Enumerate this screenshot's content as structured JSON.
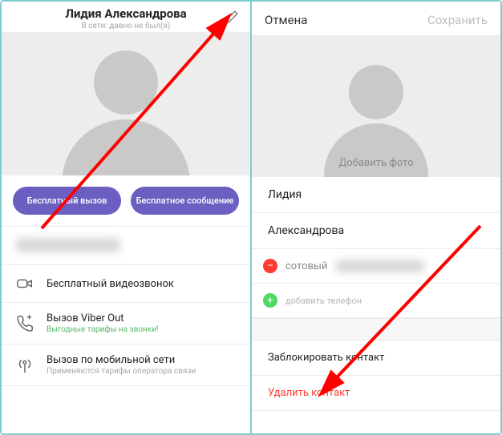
{
  "left": {
    "name": "Лидия Александрова",
    "status": "В сети: давно не был(а)",
    "buttons": {
      "free_call": "Бесплатный вызов",
      "free_msg": "Бесплатное сообщение"
    },
    "rows": {
      "video": "Бесплатный видеозвонок",
      "viber_out": "Вызов Viber Out",
      "viber_out_sub": "Выгодные тарифы на звонки!",
      "mobile": "Вызов по мобильной сети",
      "mobile_sub": "Применяются тарифы оператора связи"
    }
  },
  "right": {
    "cancel": "Отмена",
    "save": "Сохранить",
    "add_photo": "Добавить фото",
    "first_name": "Лидия",
    "last_name": "Александрова",
    "phone_label": "сотовый",
    "add_phone": "добавить телефон",
    "block": "Заблокировать контакт",
    "delete": "Удалить контакт"
  }
}
